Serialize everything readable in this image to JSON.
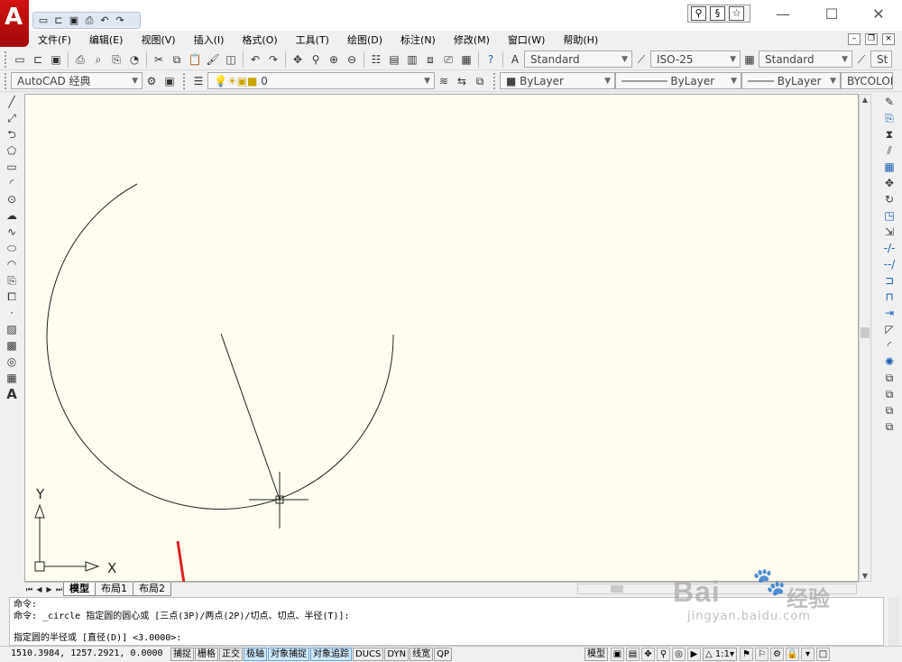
{
  "titlebar": {
    "logo_letter": "A",
    "quick_access_icons": [
      "new-icon",
      "open-icon",
      "save-icon",
      "print-icon",
      "undo-icon",
      "redo-icon"
    ],
    "window_controls": {
      "minimize": "—",
      "maximize": "☐",
      "close": "✕"
    }
  },
  "menu": {
    "items": [
      "文件(F)",
      "编辑(E)",
      "视图(V)",
      "插入(I)",
      "格式(O)",
      "工具(T)",
      "绘图(D)",
      "标注(N)",
      "修改(M)",
      "窗口(W)",
      "帮助(H)"
    ]
  },
  "toolbar": {
    "text_style": "Standard",
    "dim_style": "ISO-25",
    "table_style": "Standard",
    "multileader_style": "St",
    "workspace": "AutoCAD 经典",
    "layer": "0",
    "color": "ByLayer",
    "linetype": "ByLayer",
    "lineweight": "ByLayer",
    "plot_style": "BYCOLOR"
  },
  "canvas": {
    "background": "#fffdf0",
    "ucs_y_label": "Y",
    "ucs_x_label": "X"
  },
  "layout_tabs": [
    "模型",
    "布局1",
    "布局2"
  ],
  "command": {
    "line1": "命令:",
    "line2": "命令: _circle 指定圆的圆心或 [三点(3P)/两点(2P)/切点、切点、半径(T)]:",
    "line3": "指定圆的半径或 [直径(D)] <3.0000>:"
  },
  "status": {
    "coordinates": "1510.3984, 1257.2921, 0.0000",
    "toggles": [
      {
        "label": "捕捉",
        "on": false
      },
      {
        "label": "栅格",
        "on": false
      },
      {
        "label": "正交",
        "on": false
      },
      {
        "label": "极轴",
        "on": true
      },
      {
        "label": "对象捕捉",
        "on": true
      },
      {
        "label": "对象追踪",
        "on": true
      },
      {
        "label": "DUCS",
        "on": false
      },
      {
        "label": "DYN",
        "on": false
      },
      {
        "label": "线宽",
        "on": false
      },
      {
        "label": "QP",
        "on": false
      }
    ],
    "model_label": "模型",
    "scale": "1:1"
  },
  "watermark": {
    "brand": "Bai",
    "brand_cn": "经验",
    "url": "jingyan.baidu.com"
  },
  "colors": {
    "annotation_arrow": "#e02020",
    "toggle_on": "#cfe8fb"
  }
}
